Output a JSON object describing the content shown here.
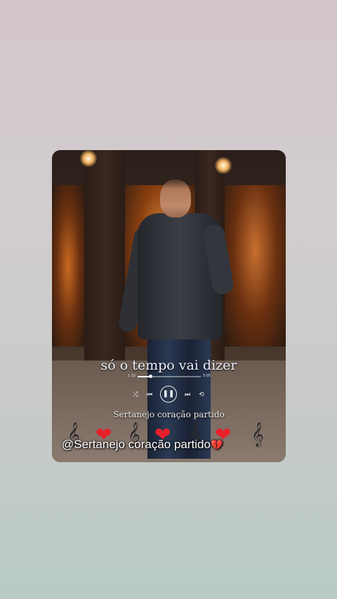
{
  "video": {
    "lyric": "só o tempo vai dizer",
    "time_elapsed": "1:32",
    "time_total": "3:05",
    "progress": 0.2,
    "song_title": "Sertanejo coração partido",
    "caption": "@Sertanejo coração partido"
  },
  "player_icons": {
    "shuffle": "shuffle-icon",
    "previous": "previous-icon",
    "pause": "pause-icon",
    "next": "next-icon",
    "repeat": "repeat-icon"
  },
  "glyphs": {
    "shuffle": "⤮",
    "previous": "⏮",
    "pause": "❚❚",
    "next": "⏭",
    "repeat": "⟲",
    "clef": "𝄞",
    "heart": "❤",
    "broken_heart": "💔"
  },
  "colors": {
    "heart": "#e8202a",
    "caption_text": "#ffffff"
  }
}
